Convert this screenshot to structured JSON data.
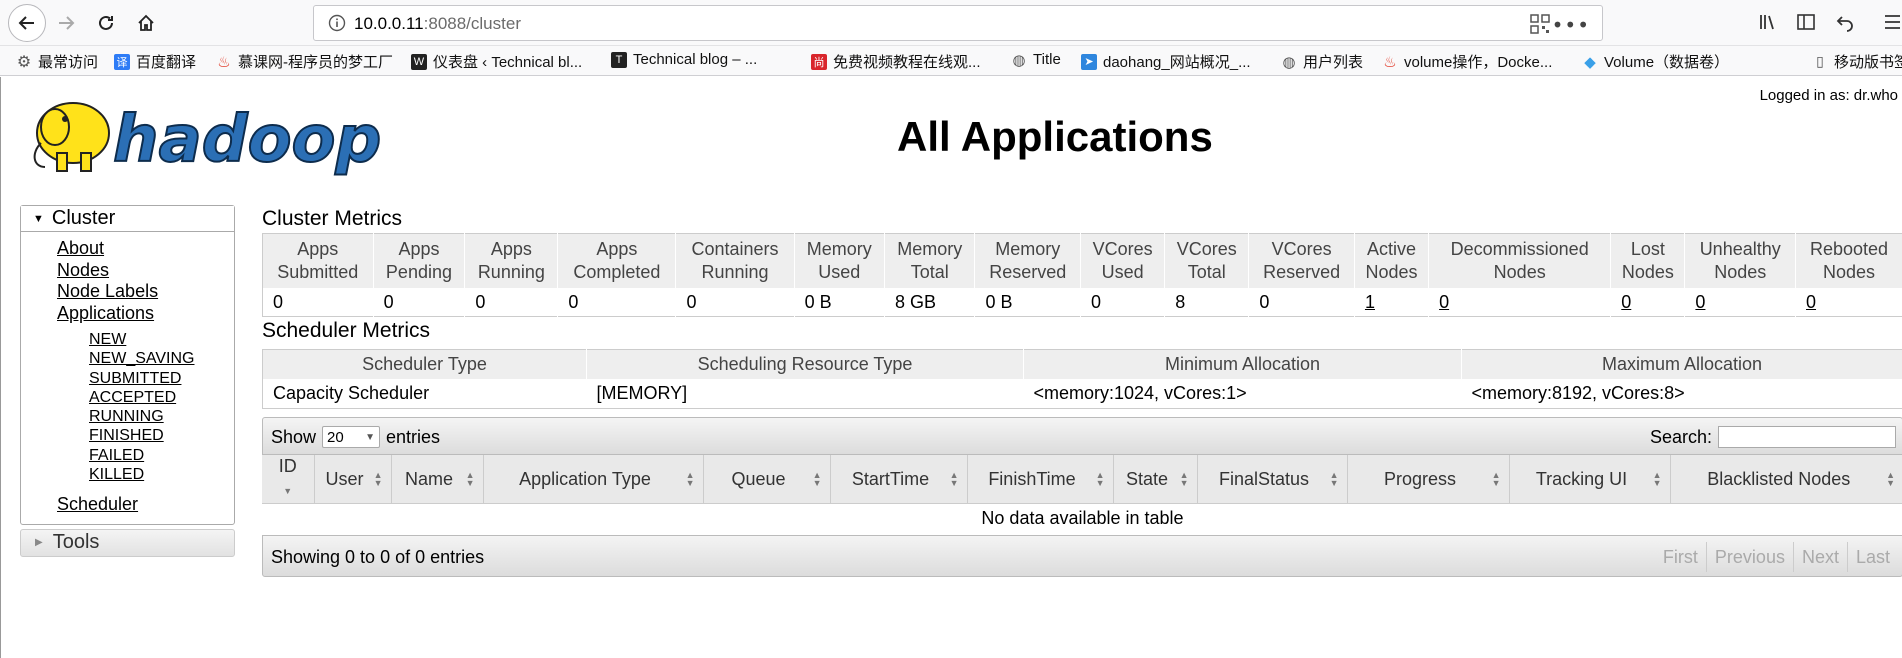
{
  "browser": {
    "url_host": "10.0.0.11",
    "url_rest": ":8088/cluster",
    "bookmarks": [
      {
        "label": "最常访问",
        "icon": "gear-icon",
        "color": "#555555"
      },
      {
        "label": "百度翻译",
        "icon": "translate-icon",
        "color": "#2e7cf6"
      },
      {
        "label": "慕课网-程序员的梦工厂",
        "icon": "flame-icon",
        "color": "#e0301e"
      },
      {
        "label": "仪表盘 ‹ Technical bl...",
        "icon": "wordpress-icon",
        "color": "#222222"
      },
      {
        "label": "Technical blog – ...",
        "icon": "blog-icon",
        "color": "#222222"
      },
      {
        "label": "免费视频教程在线观...",
        "icon": "shang-icon",
        "color": "#d9262c"
      },
      {
        "label": "Title",
        "icon": "globe-icon",
        "color": "#555555"
      },
      {
        "label": "daohang_网站概况_...",
        "icon": "nav-icon",
        "color": "#2e86de"
      },
      {
        "label": "用户列表",
        "icon": "globe-icon",
        "color": "#555555"
      },
      {
        "label": "volume操作，Docke...",
        "icon": "flame-icon",
        "color": "#e0301e"
      },
      {
        "label": "Volume（数据卷）",
        "icon": "docker-icon",
        "color": "#3aa0e8"
      },
      {
        "label": "移动版书签",
        "icon": "mobile-icon",
        "color": "#555555"
      }
    ]
  },
  "header": {
    "title": "All Applications",
    "login": "Logged in as: dr.who",
    "logo_text": "hadoop"
  },
  "sidebar": {
    "cluster_label": "Cluster",
    "links": [
      "About",
      "Nodes",
      "Node Labels",
      "Applications"
    ],
    "app_states": [
      "NEW",
      "NEW_SAVING",
      "SUBMITTED",
      "ACCEPTED",
      "RUNNING",
      "FINISHED",
      "FAILED",
      "KILLED"
    ],
    "scheduler_label": "Scheduler",
    "tools_label": "Tools"
  },
  "cluster_metrics": {
    "title": "Cluster Metrics",
    "headers": [
      [
        "Apps",
        "Submitted"
      ],
      [
        "Apps",
        "Pending"
      ],
      [
        "Apps",
        "Running"
      ],
      [
        "Apps",
        "Completed"
      ],
      [
        "Containers",
        "Running"
      ],
      [
        "Memory",
        "Used"
      ],
      [
        "Memory",
        "Total"
      ],
      [
        "Memory",
        "Reserved"
      ],
      [
        "VCores",
        "Used"
      ],
      [
        "VCores",
        "Total"
      ],
      [
        "VCores",
        "Reserved"
      ],
      [
        "Active",
        "Nodes"
      ],
      [
        "Decommissioned",
        "Nodes"
      ],
      [
        "Lost",
        "Nodes"
      ],
      [
        "Unhealthy",
        "Nodes"
      ],
      [
        "Rebooted",
        "Nodes"
      ]
    ],
    "values": [
      "0",
      "0",
      "0",
      "0",
      "0",
      "0 B",
      "8 GB",
      "0 B",
      "0",
      "8",
      "0",
      "1",
      "0",
      "0",
      "0",
      "0"
    ],
    "linked": [
      false,
      false,
      false,
      false,
      false,
      false,
      false,
      false,
      false,
      false,
      false,
      true,
      true,
      true,
      true,
      true
    ]
  },
  "scheduler_metrics": {
    "title": "Scheduler Metrics",
    "headers": [
      "Scheduler Type",
      "Scheduling Resource Type",
      "Minimum Allocation",
      "Maximum Allocation"
    ],
    "values": [
      "Capacity Scheduler",
      "[MEMORY]",
      "<memory:1024, vCores:1>",
      "<memory:8192, vCores:8>"
    ]
  },
  "apps_table": {
    "show_label": "Show",
    "page_length": "20",
    "entries_label": "entries",
    "search_label": "Search:",
    "columns": [
      "ID",
      "User",
      "Name",
      "Application Type",
      "Queue",
      "StartTime",
      "FinishTime",
      "State",
      "FinalStatus",
      "Progress",
      "Tracking UI",
      "Blacklisted Nodes"
    ],
    "empty_message": "No data available in table",
    "info": "Showing 0 to 0 of 0 entries",
    "pager": [
      "First",
      "Previous",
      "Next",
      "Last"
    ]
  }
}
